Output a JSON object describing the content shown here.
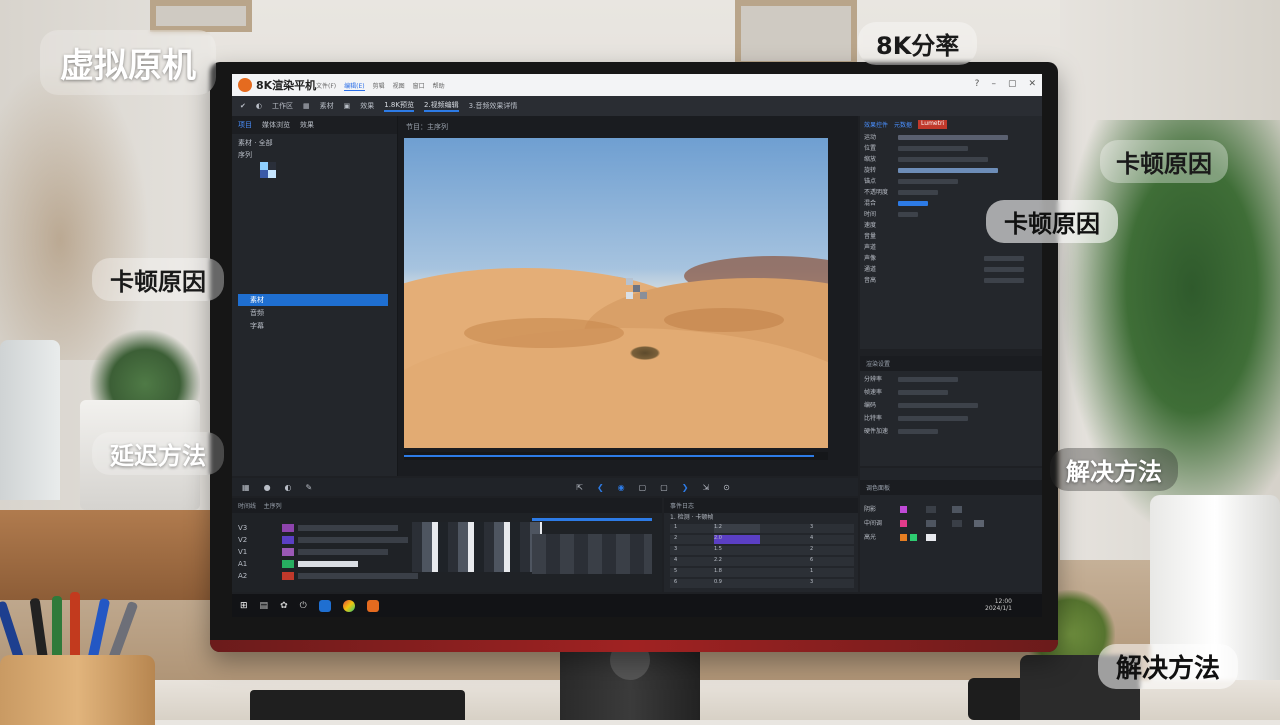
{
  "overlay_labels": {
    "top_left": "虚拟原机",
    "top_center": "8K分率",
    "right_upper": "卡顿原因",
    "screen_right": "卡顿原因",
    "left_middle": "卡顿原因",
    "left_lower": "延迟方法",
    "right_middle": "解决方法",
    "bottom_right": "解决方法"
  },
  "app": {
    "title": "8K渲染平机",
    "menu": [
      "文件(F)",
      "编辑(E)",
      "剪辑",
      "视图",
      "窗口",
      "帮助"
    ],
    "active_menu_index": 1,
    "window_buttons": [
      "?",
      "–",
      "▢",
      "✕"
    ]
  },
  "toolbar": {
    "items": [
      "✔",
      "◐",
      "工作区",
      "▦",
      "素材",
      "▣",
      "效果",
      "1.8K预览",
      "2.视频编辑",
      "3.音频效果详情"
    ],
    "active_index": 7
  },
  "left_panel": {
    "tabs": [
      "项目",
      "媒体浏览",
      "效果"
    ],
    "active_tab": 0,
    "header": "素材 · 全部",
    "sub": "序列",
    "items": [
      "素材",
      "音频",
      "字幕"
    ],
    "selected_index": 0
  },
  "preview": {
    "label": "节目：主序列"
  },
  "right_panel": {
    "tabs": [
      "效果控件",
      "元数据",
      "Lumetri"
    ],
    "rows": [
      "运动",
      "位置",
      "缩放",
      "旋转",
      "锚点",
      "不透明度",
      "混合",
      "时间",
      "速度",
      "音量",
      "声道",
      "声像",
      "通道",
      "音高"
    ]
  },
  "right_panel_2": {
    "header": "渲染设置",
    "rows": [
      "分辨率",
      "帧速率",
      "编码",
      "比特率",
      "硬件加速"
    ]
  },
  "bottom_left": {
    "tab": "时间线",
    "sub": "主序列",
    "tracks": [
      "V3",
      "V2",
      "V1",
      "A1",
      "A2"
    ]
  },
  "bottom_middle": {
    "header": "事件日志",
    "sub": "1. 检测 · 卡顿帧",
    "rows": [
      {
        "a": "1",
        "b": "1.2",
        "c": "3"
      },
      {
        "a": "2",
        "b": "2.0",
        "c": "4"
      },
      {
        "a": "3",
        "b": "1.5",
        "c": "2"
      },
      {
        "a": "4",
        "b": "2.2",
        "c": "6"
      },
      {
        "a": "5",
        "b": "1.8",
        "c": "1"
      },
      {
        "a": "6",
        "b": "0.9",
        "c": "3"
      }
    ]
  },
  "bottom_right": {
    "header": "调色面板",
    "rows": [
      "阴影",
      "中间调",
      "高光"
    ]
  },
  "taskbar": {
    "time": "12:00",
    "date": "2024/1/1"
  },
  "colors": {
    "accent_blue": "#2d7be6",
    "app_logo": "#e56b1f",
    "selected_row": "#1f6fd1"
  }
}
